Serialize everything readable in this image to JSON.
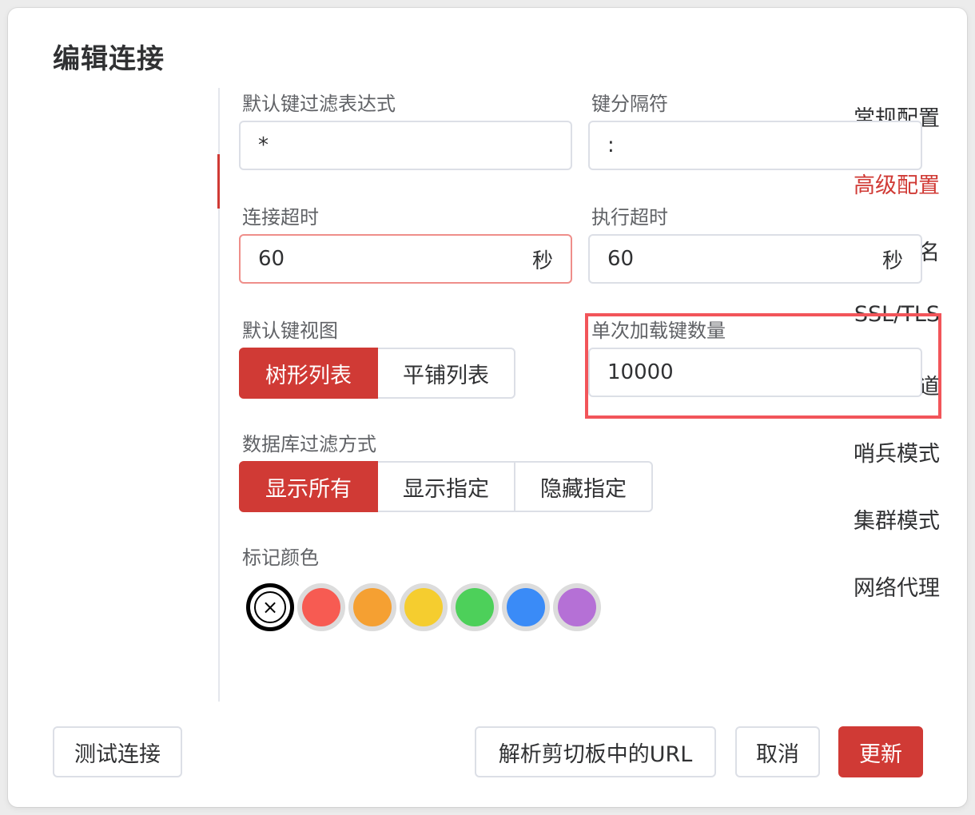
{
  "dialog": {
    "title": "编辑连接"
  },
  "sidebar": {
    "items": [
      {
        "label": "常规配置"
      },
      {
        "label": "高级配置",
        "active": true
      },
      {
        "label": "数据库别名"
      },
      {
        "label": "SSL/TLS"
      },
      {
        "label": "SSH隧道"
      },
      {
        "label": "哨兵模式"
      },
      {
        "label": "集群模式"
      },
      {
        "label": "网络代理"
      }
    ]
  },
  "form": {
    "key_filter": {
      "label": "默认键过滤表达式",
      "value": "*"
    },
    "key_separator": {
      "label": "键分隔符",
      "value": ":"
    },
    "conn_timeout": {
      "label": "连接超时",
      "value": "60",
      "suffix": "秒"
    },
    "exec_timeout": {
      "label": "执行超时",
      "value": "60",
      "suffix": "秒"
    },
    "key_view": {
      "label": "默认键视图",
      "options": [
        "树形列表",
        "平铺列表"
      ],
      "selected": "树形列表"
    },
    "load_size": {
      "label": "单次加载键数量",
      "value": "10000"
    },
    "db_filter": {
      "label": "数据库过滤方式",
      "options": [
        "显示所有",
        "显示指定",
        "隐藏指定"
      ],
      "selected": "显示所有"
    },
    "mark_color": {
      "label": "标记颜色",
      "clear_icon": "×",
      "colors": [
        "#f75b52",
        "#f5a032",
        "#f5cd2f",
        "#4dd05a",
        "#3a8bf7",
        "#b570d6"
      ]
    }
  },
  "footer": {
    "test_label": "测试连接",
    "parse_label": "解析剪切板中的URL",
    "cancel_label": "取消",
    "update_label": "更新"
  },
  "colors": {
    "accent": "#d03a35",
    "highlight": "#f2555a"
  }
}
